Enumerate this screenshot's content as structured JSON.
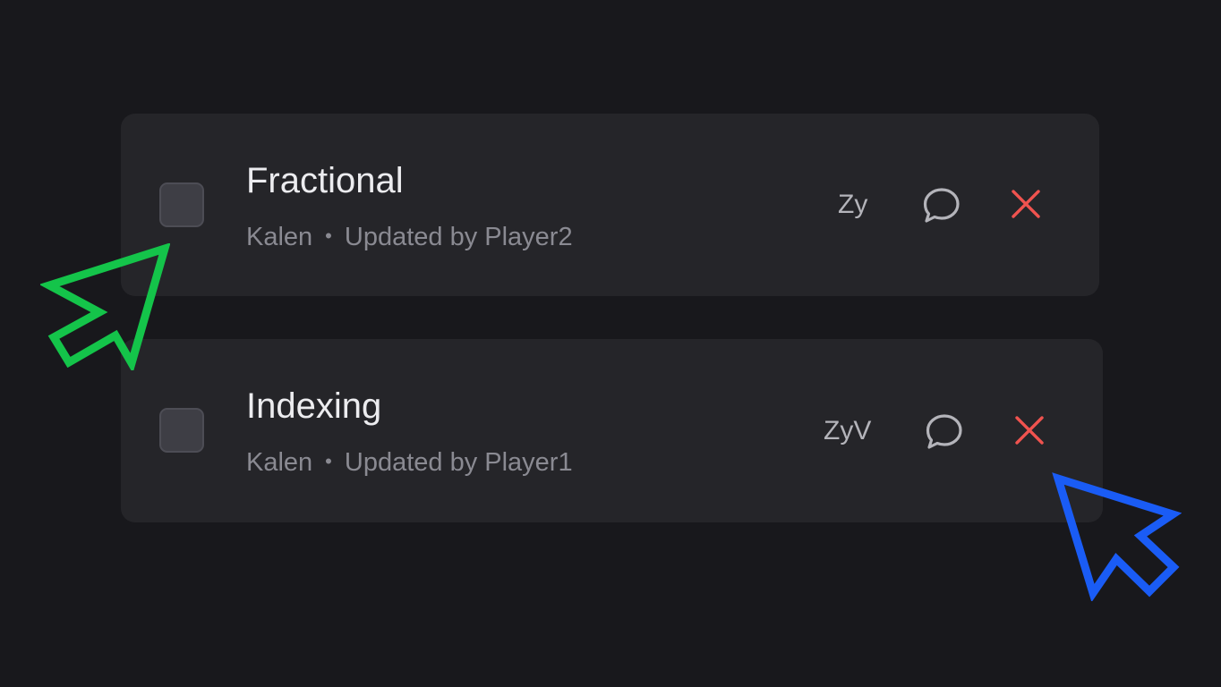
{
  "tasks": [
    {
      "title": "Fractional",
      "owner": "Kalen",
      "separator": "•",
      "updated": "Updated by Player2",
      "initials": "Zy",
      "checked": false
    },
    {
      "title": "Indexing",
      "owner": "Kalen",
      "separator": "•",
      "updated": "Updated by Player1",
      "initials": "ZyV",
      "checked": false
    }
  ],
  "icons": {
    "comment": "speech-bubble-icon",
    "delete": "close-x-icon",
    "cursor_green": "green-arrow-cursor",
    "cursor_blue": "blue-arrow-cursor"
  },
  "colors": {
    "background": "#18181c",
    "card": "#252529",
    "delete_red": "#f0534f",
    "cursor_green": "#14c44a",
    "cursor_blue": "#1a5cf5"
  }
}
